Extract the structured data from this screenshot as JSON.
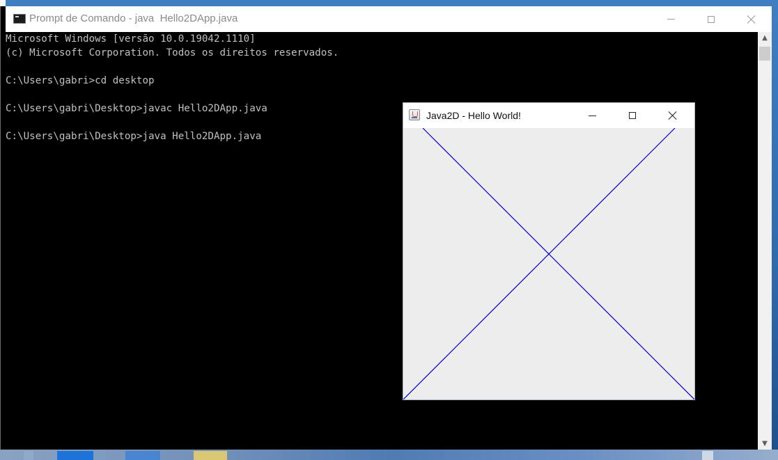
{
  "console_window": {
    "title": "Prompt de Comando - java  Hello2DApp.java",
    "lines": [
      "Microsoft Windows [versão 10.0.19042.1110]",
      "(c) Microsoft Corporation. Todos os direitos reservados.",
      "",
      "C:\\Users\\gabri>cd desktop",
      "",
      "C:\\Users\\gabri\\Desktop>javac Hello2DApp.java",
      "",
      "C:\\Users\\gabri\\Desktop>java Hello2DApp.java"
    ],
    "text_color": "#c0c0c0",
    "background": "#000000",
    "icon": "console-icon"
  },
  "java_window": {
    "title": "Java2D - Hello World!",
    "icon": "java-coffee-icon",
    "canvas_background": "#ededed",
    "line_color": "#0000cc"
  },
  "window_controls": {
    "minimize": "minimize-icon",
    "maximize": "maximize-icon",
    "close": "close-icon"
  }
}
